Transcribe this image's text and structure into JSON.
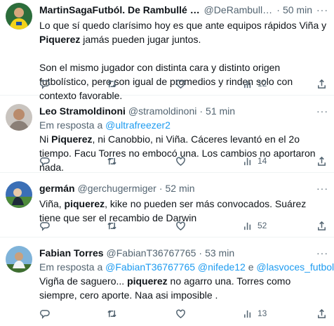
{
  "tweets": [
    {
      "name": "MartinSagaFutból. De Rambullé y Taqu...",
      "handle": "@DeRambulleyT...",
      "time": "50 min",
      "reply_prefix": "",
      "mentions": [],
      "text_parts": [
        {
          "t": "Lo que sí quedo clarísimo hoy es que ante equipos rápidos Viña y ",
          "b": false
        },
        {
          "t": "Piquerez",
          "b": true
        },
        {
          "t": " jamás pueden jugar juntos.",
          "b": false
        }
      ],
      "text2": "Son el mismo jugador con distinta cara y distinto origen futbolístico, pero son igual de promedios y rinden solo con contexto favorable.",
      "views": "12"
    },
    {
      "name": "Leo Stramoldinoni",
      "handle": "@stramoldinoni",
      "time": "51 min",
      "reply_prefix": "Em resposta a",
      "mentions": [
        "@ultrafreezer2"
      ],
      "text_parts": [
        {
          "t": "Ni ",
          "b": false
        },
        {
          "t": "Piquerez",
          "b": true
        },
        {
          "t": ", ni Canobbio, ni Viña. Cáceres levantó en el 2o tiempo. Facu Torres no embocó una. Los cambios no aportaron nada.",
          "b": false
        }
      ],
      "text2": "",
      "views": "14"
    },
    {
      "name": "germán",
      "handle": "@gerchugermiger",
      "time": "52 min",
      "reply_prefix": "",
      "mentions": [],
      "text_parts": [
        {
          "t": "Viña, ",
          "b": false
        },
        {
          "t": "piquerez",
          "b": true
        },
        {
          "t": ", kike no pueden ser más convocados. Suárez tiene que ser el recambio de Darwin",
          "b": false
        }
      ],
      "text2": "",
      "views": "52"
    },
    {
      "name": "Fabian Torres",
      "handle": "@FabianT36767765",
      "time": "53 min",
      "reply_prefix": "Em resposta a",
      "mentions": [
        "@FabianT36767765",
        "@nifede12",
        "@lasvoces_futbol"
      ],
      "mention_joiner": "e",
      "text_parts": [
        {
          "t": "Vigña de saguero... ",
          "b": false
        },
        {
          "t": "piquerez",
          "b": true
        },
        {
          "t": " no agarro una. Torres como siempre, cero aporte. Naa asi imposible .",
          "b": false
        }
      ],
      "text2": "",
      "views": "13"
    }
  ],
  "sep": "·",
  "more": "···",
  "icons": [
    "reply-icon",
    "retweet-icon",
    "like-icon",
    "views-icon",
    "share-icon"
  ],
  "colors": {
    "link": "#1d9bf0",
    "muted": "#536471",
    "text": "#0f1419",
    "divider": "#eff3f4"
  }
}
